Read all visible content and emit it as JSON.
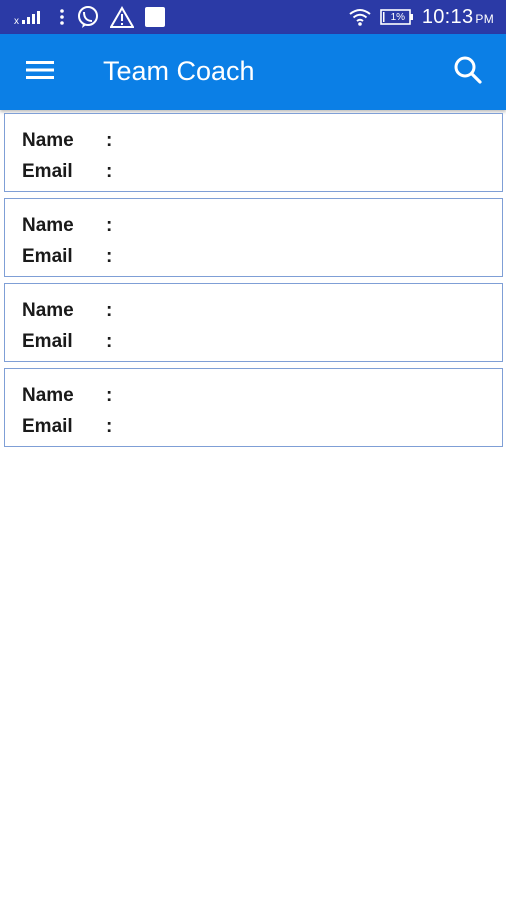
{
  "status_bar": {
    "time": "10:13",
    "ampm": "PM",
    "battery": "1%",
    "icons": [
      "signal-icon",
      "more-vert-icon",
      "viber-icon",
      "warning-icon",
      "notification-icon",
      "wifi-icon",
      "battery-icon"
    ]
  },
  "app_bar": {
    "title": "Team Coach",
    "menu_icon": "hamburger-menu-icon",
    "search_icon": "search-icon",
    "background": "#0b7fe6"
  },
  "cards": [
    {
      "name_label": "Name",
      "email_label": "Email",
      "separator": ":",
      "name_value": "",
      "email_value": ""
    },
    {
      "name_label": "Name",
      "email_label": "Email",
      "separator": ":",
      "name_value": "",
      "email_value": ""
    },
    {
      "name_label": "Name",
      "email_label": "Email",
      "separator": ":",
      "name_value": "",
      "email_value": ""
    },
    {
      "name_label": "Name",
      "email_label": "Email",
      "separator": ":",
      "name_value": "",
      "email_value": ""
    }
  ],
  "colors": {
    "status_bar": "#2b3aa6",
    "card_border": "#7f9fd6"
  }
}
